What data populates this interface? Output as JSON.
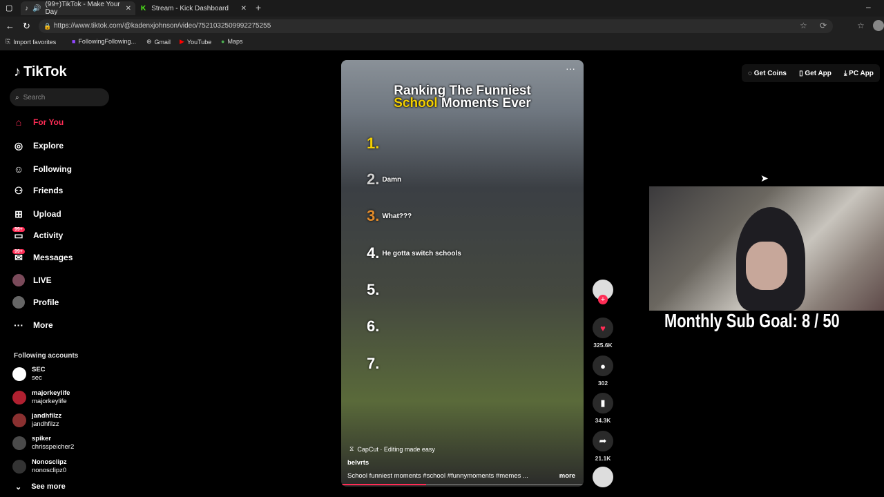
{
  "browser": {
    "tabs": [
      {
        "label": "(99+)TikTok - Make Your Day"
      },
      {
        "label": "Stream - Kick Dashboard"
      }
    ],
    "url": "https://www.tiktok.com/@kadenxjohnson/video/7521032509992275255",
    "bookmarks": [
      "Import favorites",
      "FollowingFollowing...",
      "Gmail",
      "YouTube",
      "Maps"
    ]
  },
  "tiktok": {
    "logo": "TikTok",
    "search_placeholder": "Search",
    "nav": [
      {
        "label": "For You"
      },
      {
        "label": "Explore"
      },
      {
        "label": "Following"
      },
      {
        "label": "Friends"
      },
      {
        "label": "Upload"
      },
      {
        "label": "Activity",
        "badge": "99+"
      },
      {
        "label": "Messages",
        "badge": "99+"
      },
      {
        "label": "LIVE"
      },
      {
        "label": "Profile"
      },
      {
        "label": "More"
      }
    ],
    "following_header": "Following accounts",
    "accounts": [
      {
        "name": "SEC",
        "handle": "sec"
      },
      {
        "name": "majorkeylife",
        "handle": "majorkeylife"
      },
      {
        "name": "jandhfilzz",
        "handle": "jandhfilzz"
      },
      {
        "name": "spiker",
        "handle": "chrisspeicher2"
      },
      {
        "name": "Nonosclipz",
        "handle": "nonosclipz0"
      }
    ],
    "see_more": "See more",
    "top_actions": [
      "Get Coins",
      "Get App",
      "PC App"
    ]
  },
  "video": {
    "title_line1": "Ranking The Funniest",
    "title_hl": "School",
    "title_line2_rest": " Moments Ever",
    "ranks": [
      {
        "num": "1.",
        "caption": "",
        "color": "#f4d000"
      },
      {
        "num": "2.",
        "caption": "Damn",
        "color": "#d0d0d0"
      },
      {
        "num": "3.",
        "caption": "What???",
        "color": "#e08a2a"
      },
      {
        "num": "4.",
        "caption": "He gotta switch schools",
        "color": "#ffffff"
      },
      {
        "num": "5.",
        "caption": "",
        "color": "#ffffff"
      },
      {
        "num": "6.",
        "caption": "",
        "color": "#ffffff"
      },
      {
        "num": "7.",
        "caption": "",
        "color": "#ffffff"
      }
    ],
    "capcut": "CapCut · Editing made easy",
    "author": "belvrts",
    "description": "School funniest moments #school  #funnymoments  #memes ...",
    "more": "more",
    "progress": 0.35,
    "stats": {
      "likes": "325.6K",
      "comments": "302",
      "saves": "34.3K",
      "shares": "21.1K"
    }
  },
  "overlay": {
    "sub_goal": "Monthly Sub Goal:  8 / 50"
  }
}
